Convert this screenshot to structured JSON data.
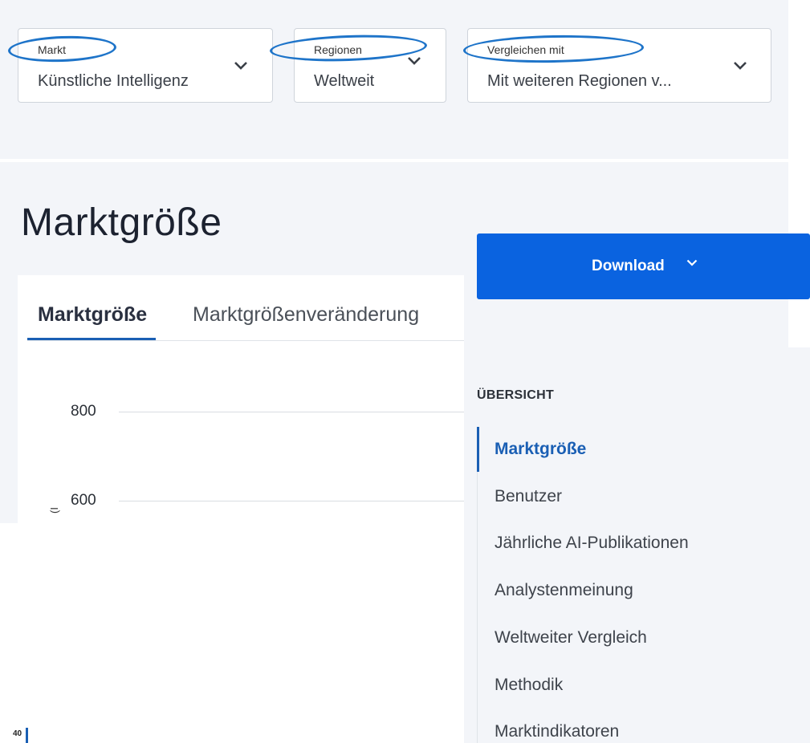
{
  "filters": [
    {
      "label": "Markt",
      "value": "Künstliche Intelligenz"
    },
    {
      "label": "Regionen",
      "value": "Weltweit"
    },
    {
      "label": "Vergleichen mit",
      "value": "Mit weiteren Regionen v..."
    }
  ],
  "page_title": "Marktgröße",
  "tabs": [
    "Marktgröße",
    "Marktgrößenveränderung"
  ],
  "chart": {
    "y_ticks": [
      "800",
      "600",
      "40"
    ],
    "axis_unit_fragment": "(I"
  },
  "download": {
    "label": "Download"
  },
  "sidebar": {
    "title": "ÜBERSICHT",
    "items": [
      "Marktgröße",
      "Benutzer",
      "Jährliche AI-Publikationen",
      "Analystenmeinung",
      "Weltweiter Vergleich",
      "Methodik",
      "Marktindikatoren"
    ]
  },
  "colors": {
    "accent": "#0a63e0",
    "highlight_circle": "#1e74c9",
    "background": "#f3f5f9"
  }
}
